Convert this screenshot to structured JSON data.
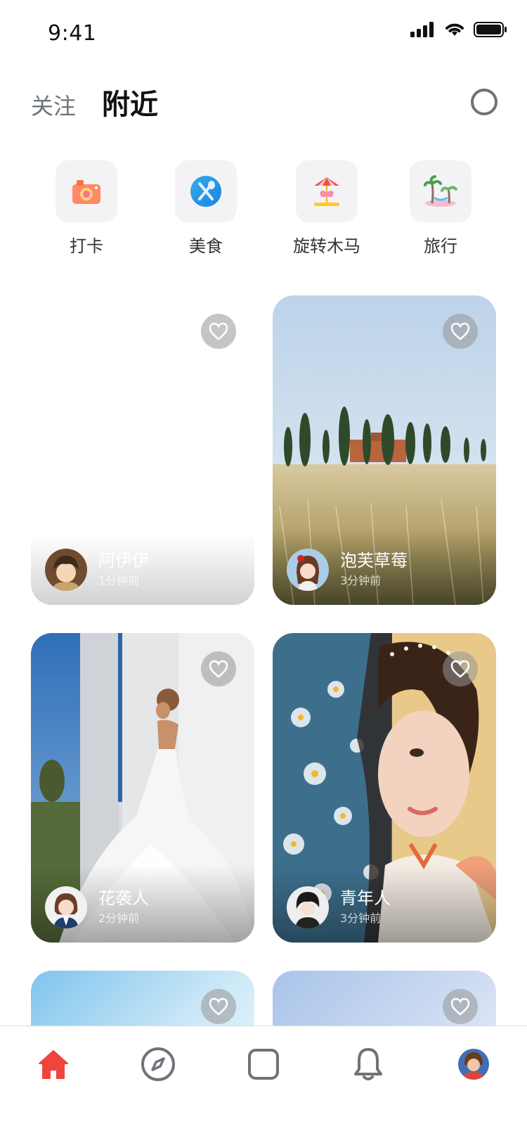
{
  "status_bar": {
    "time": "9:41"
  },
  "header": {
    "tab_follow": "关注",
    "tab_nearby": "附近"
  },
  "categories": [
    {
      "label": "打卡",
      "icon": "camera-icon"
    },
    {
      "label": "美食",
      "icon": "utensils-icon"
    },
    {
      "label": "旋转木马",
      "icon": "carousel-icon"
    },
    {
      "label": "旅行",
      "icon": "beach-icon"
    }
  ],
  "posts": [
    {
      "username": "阿伊伊",
      "time": "1分钟前"
    },
    {
      "username": "泡芙草莓",
      "time": "3分钟前"
    },
    {
      "username": "花袭人",
      "time": "2分钟前"
    },
    {
      "username": "青年人",
      "time": "3分钟前"
    }
  ],
  "colors": {
    "accent": "#f0443d",
    "muted": "#6e737a"
  },
  "bottom_nav": [
    {
      "name": "home",
      "icon": "home-icon",
      "active": true
    },
    {
      "name": "discover",
      "icon": "compass-icon"
    },
    {
      "name": "create",
      "icon": "square-icon"
    },
    {
      "name": "notifications",
      "icon": "bell-icon"
    },
    {
      "name": "profile",
      "icon": "avatar"
    }
  ]
}
